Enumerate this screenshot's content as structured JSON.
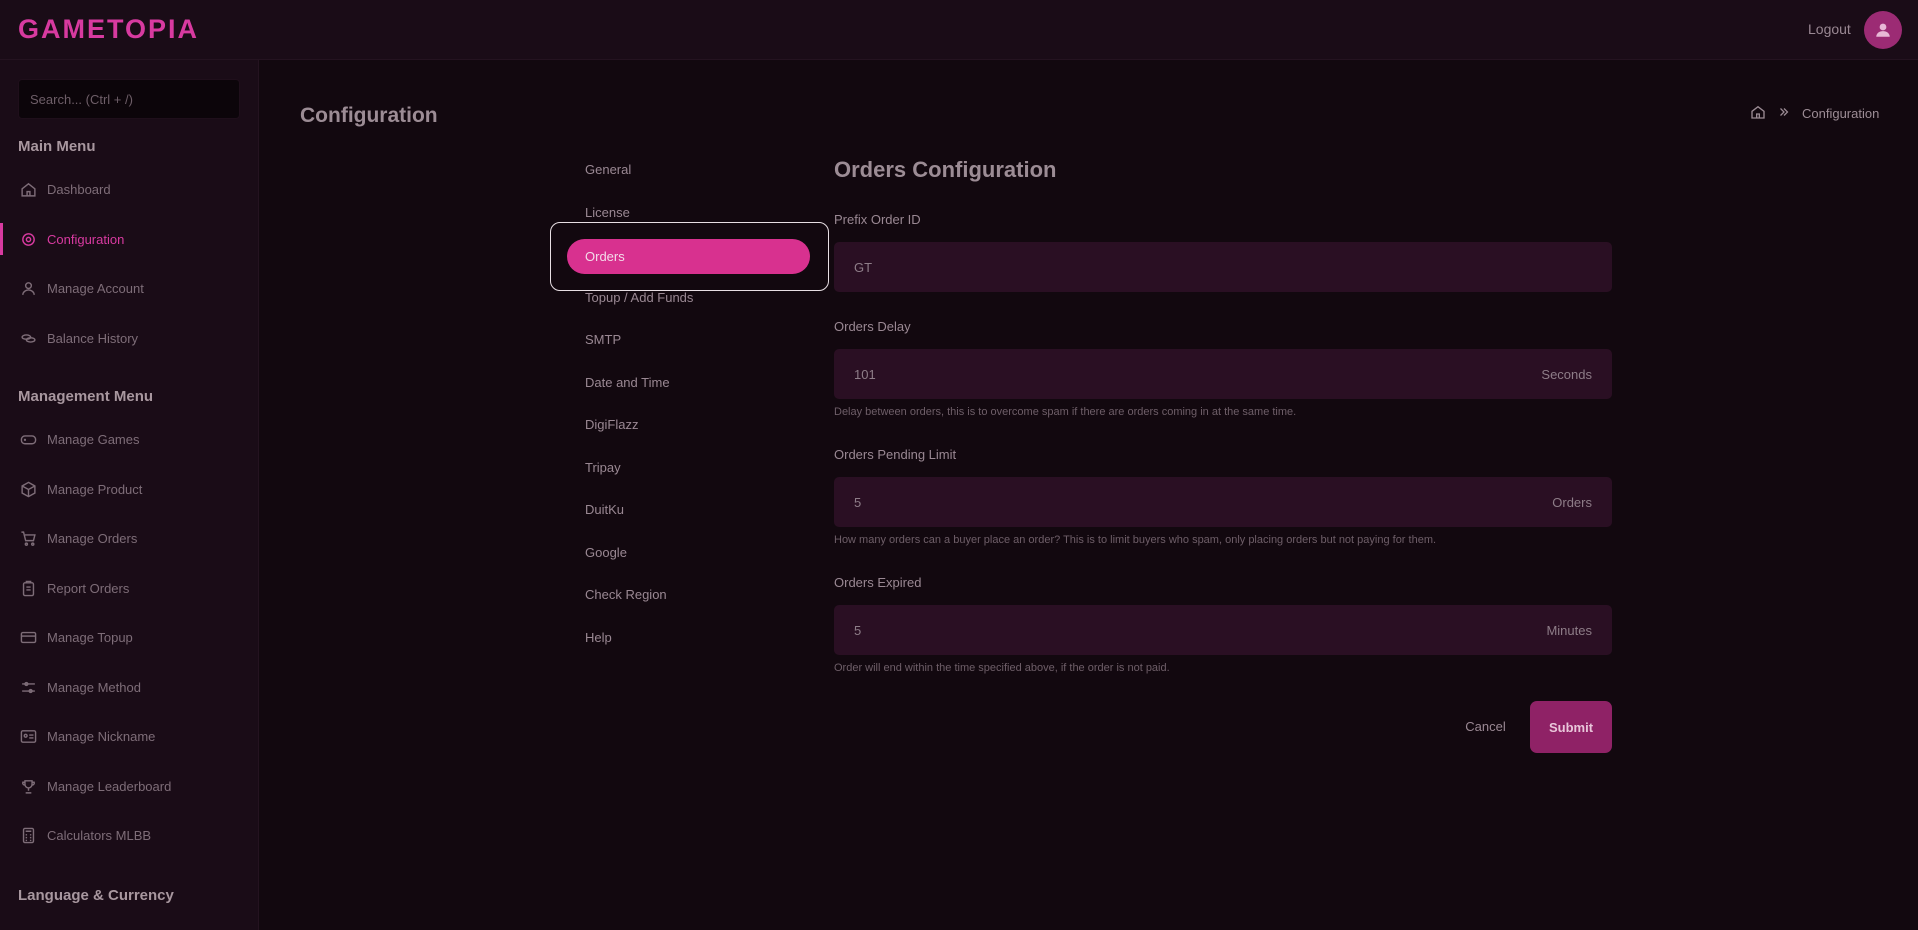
{
  "app": {
    "logo": "GAMETOPIA"
  },
  "header": {
    "logout_label": "Logout",
    "avatar_icon": "user-icon"
  },
  "sidebar": {
    "search_placeholder": "Search... (Ctrl + /)",
    "main_menu_heading": "Main Menu",
    "main_items": [
      {
        "label": "Dashboard",
        "icon": "home-icon"
      },
      {
        "label": "Configuration",
        "icon": "gear-icon",
        "active": true
      },
      {
        "label": "Manage Account",
        "icon": "user-icon"
      },
      {
        "label": "Balance History",
        "icon": "coins-icon"
      }
    ],
    "management_menu_heading": "Management Menu",
    "management_items": [
      {
        "label": "Manage Games",
        "icon": "gamepad-icon"
      },
      {
        "label": "Manage Product",
        "icon": "box-icon"
      },
      {
        "label": "Manage Orders",
        "icon": "cart-icon"
      },
      {
        "label": "Report Orders",
        "icon": "clipboard-icon"
      },
      {
        "label": "Manage Topup",
        "icon": "card-icon"
      },
      {
        "label": "Manage Method",
        "icon": "sliders-icon"
      },
      {
        "label": "Manage Nickname",
        "icon": "id-card-icon"
      },
      {
        "label": "Manage Leaderboard",
        "icon": "trophy-icon"
      },
      {
        "label": "Calculators MLBB",
        "icon": "calculator-icon"
      }
    ],
    "language_heading": "Language & Currency"
  },
  "page": {
    "title": "Configuration",
    "breadcrumb": {
      "home_icon": "home-icon",
      "separator_icon": "double-chevron-right-icon",
      "current": "Configuration"
    }
  },
  "config_nav": [
    {
      "label": "General"
    },
    {
      "label": "License"
    },
    {
      "label": "Orders",
      "active": true
    },
    {
      "label": "Topup / Add Funds"
    },
    {
      "label": "SMTP"
    },
    {
      "label": "Date and Time"
    },
    {
      "label": "DigiFlazz"
    },
    {
      "label": "Tripay"
    },
    {
      "label": "DuitKu"
    },
    {
      "label": "Google"
    },
    {
      "label": "Check Region"
    },
    {
      "label": "Help"
    }
  ],
  "form": {
    "title": "Orders Configuration",
    "prefix": {
      "label": "Prefix Order ID",
      "value": "GT"
    },
    "delay": {
      "label": "Orders Delay",
      "value": "101",
      "suffix": "Seconds",
      "hint": "Delay between orders, this is to overcome spam if there are orders coming in at the same time."
    },
    "pending": {
      "label": "Orders Pending Limit",
      "value": "5",
      "suffix": "Orders",
      "hint": "How many orders can a buyer place an order? This is to limit buyers who spam, only placing orders but not paying for them."
    },
    "expired": {
      "label": "Orders Expired",
      "value": "5",
      "suffix": "Minutes",
      "hint": "Order will end within the time specified above, if the order is not paid."
    },
    "cancel_label": "Cancel",
    "submit_label": "Submit"
  },
  "colors": {
    "accent": "#d83aa0",
    "field_bg": "#2a0f23",
    "submit_bg": "#8f2266"
  }
}
